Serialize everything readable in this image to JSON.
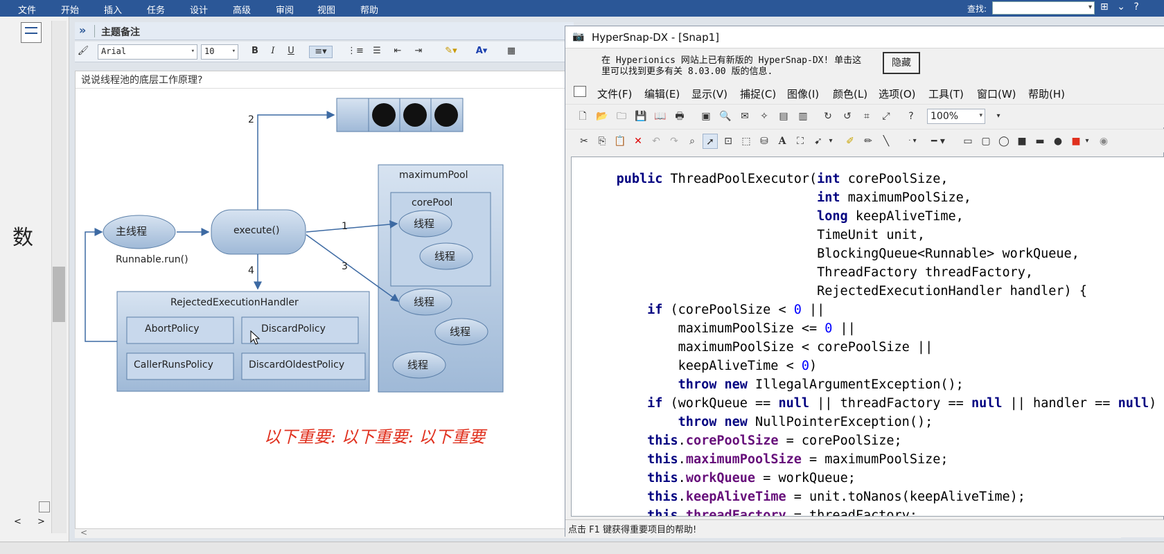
{
  "menubar": {
    "items": [
      "文件",
      "开始",
      "插入",
      "任务",
      "设计",
      "高级",
      "审阅",
      "视图",
      "帮助"
    ],
    "search_label": "查找:",
    "search_value": ""
  },
  "left": {
    "big_char": "数"
  },
  "note": {
    "header_title": "主题备注",
    "font_name": "Arial",
    "font_size": "10",
    "question": "说说线程池的底层工作原理?",
    "red_text": "以下重要:  以下重要:  以下重要"
  },
  "diagram": {
    "main_thread": "主线程",
    "runnable": "Runnable.run()",
    "execute": "execute()",
    "edges": [
      "1",
      "2",
      "3",
      "4"
    ],
    "maximum_pool": "maximumPool",
    "core_pool": "corePool",
    "thread_label": "线程",
    "handler_title": "RejectedExecutionHandler",
    "policies": [
      "AbortPolicy",
      "DiscardPolicy",
      "CallerRunsPolicy",
      "DiscardOldestPolicy"
    ]
  },
  "hypersnap": {
    "title": "HyperSnap-DX - [Snap1]",
    "info_line1": "在 Hyperionics 网站上已有新版的 HyperSnap-DX! 单击这",
    "info_line2": "里可以找到更多有关 8.03.00 版的信息.",
    "hide_button": "隐藏",
    "menu": [
      "文件(F)",
      "编辑(E)",
      "显示(V)",
      "捕捉(C)",
      "图像(I)",
      "颜色(L)",
      "选项(O)",
      "工具(T)",
      "窗口(W)",
      "帮助(H)"
    ],
    "zoom": "100%",
    "status": "点击 F1 键获得重要项目的帮助!"
  },
  "code_lines": [
    "    public ThreadPoolExecutor(int corePoolSize,",
    "                              int maximumPoolSize,",
    "                              long keepAliveTime,",
    "                              TimeUnit unit,",
    "                              BlockingQueue<Runnable> workQueue,",
    "                              ThreadFactory threadFactory,",
    "                              RejectedExecutionHandler handler) {",
    "        if (corePoolSize < 0 ||",
    "            maximumPoolSize <= 0 ||",
    "            maximumPoolSize < corePoolSize ||",
    "            keepAliveTime < 0)",
    "            throw new IllegalArgumentException();",
    "        if (workQueue == null || threadFactory == null || handler == null)",
    "            throw new NullPointerException();",
    "        this.corePoolSize = corePoolSize;",
    "        this.maximumPoolSize = maximumPoolSize;",
    "        this.workQueue = workQueue;",
    "        this.keepAliveTime = unit.toNanos(keepAliveTime);",
    "        this.threadFactory = threadFactory;"
  ],
  "colors": {
    "menubar": "#2b5797",
    "accent_red": "#e0301e",
    "diagram_fill": "#b9cde3",
    "diagram_stroke": "#5b7fa8"
  }
}
